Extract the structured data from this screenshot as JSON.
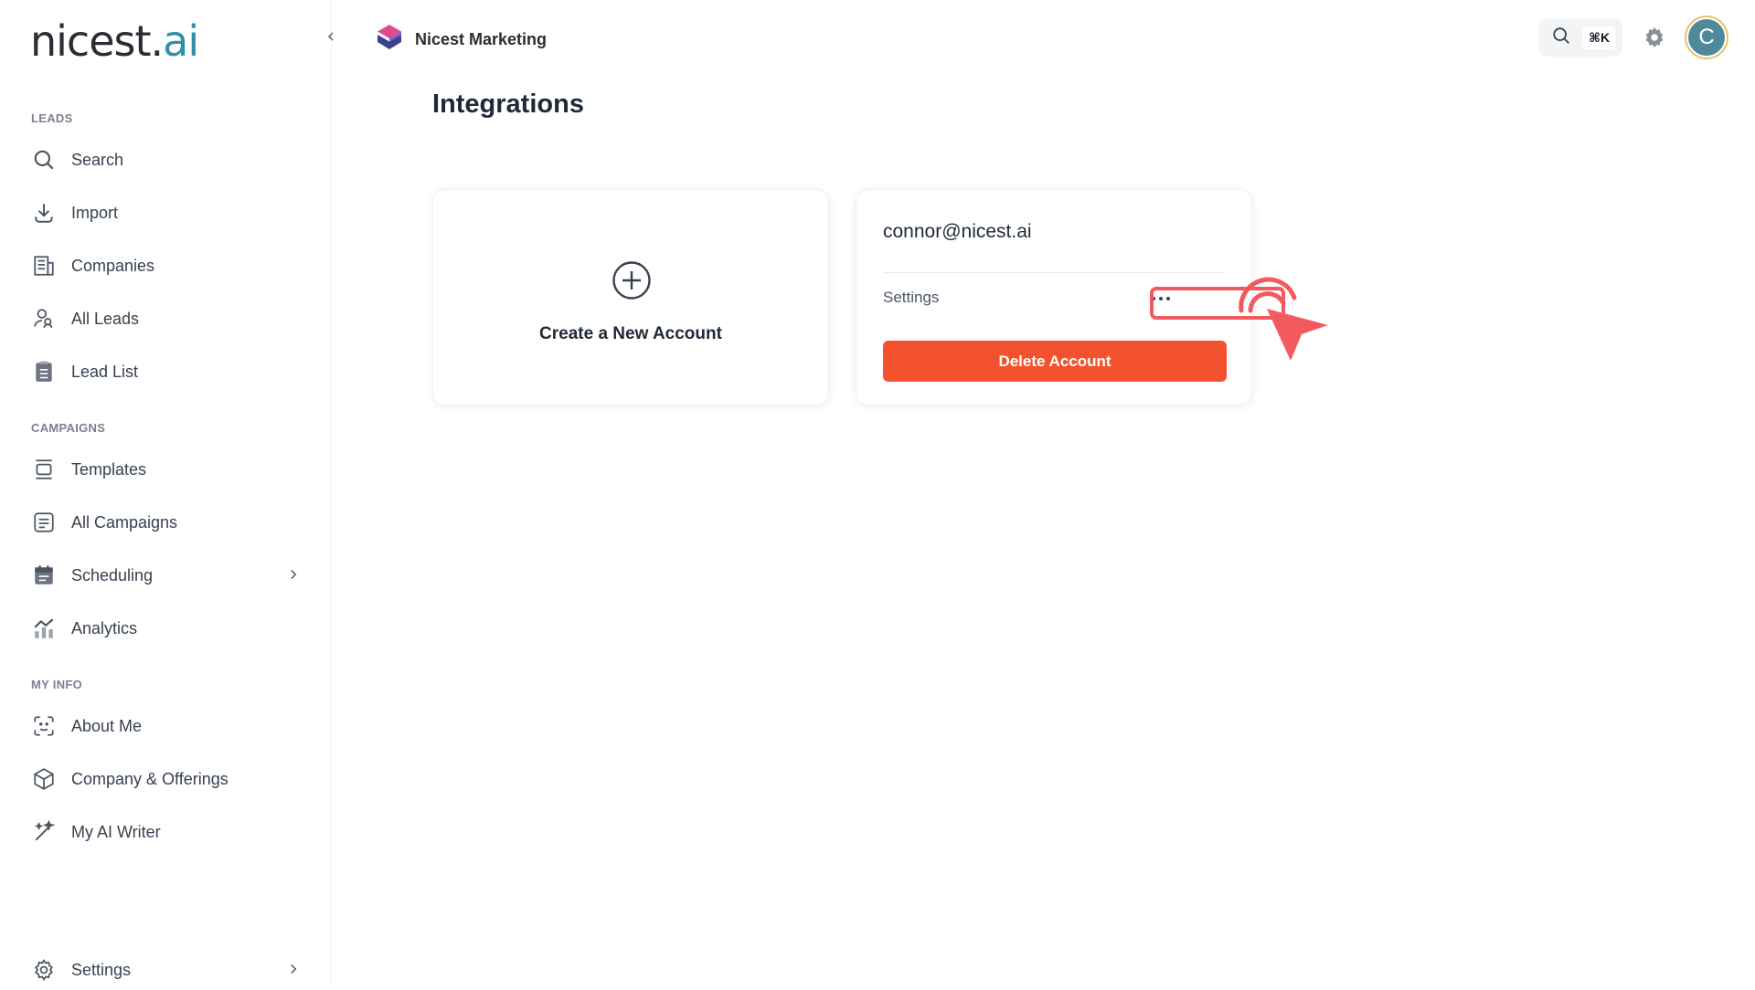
{
  "brand": {
    "logo_main": "nicest.",
    "logo_accent": "ai"
  },
  "sidebar": {
    "sections": {
      "leads": "LEADS",
      "campaigns": "CAMPAIGNS",
      "my_info": "MY INFO"
    },
    "items": [
      {
        "label": "Search",
        "icon": "search-icon"
      },
      {
        "label": "Import",
        "icon": "download-icon"
      },
      {
        "label": "Companies",
        "icon": "building-icon"
      },
      {
        "label": "All Leads",
        "icon": "users-icon"
      },
      {
        "label": "Lead List",
        "icon": "clipboard-list-icon"
      },
      {
        "label": "Templates",
        "icon": "template-icon"
      },
      {
        "label": "All Campaigns",
        "icon": "campaigns-icon"
      },
      {
        "label": "Scheduling",
        "icon": "calendar-icon"
      },
      {
        "label": "Analytics",
        "icon": "chart-icon"
      },
      {
        "label": "About Me",
        "icon": "face-icon"
      },
      {
        "label": "Company & Offerings",
        "icon": "box-icon"
      },
      {
        "label": "My AI Writer",
        "icon": "magic-wand-icon"
      },
      {
        "label": "Settings",
        "icon": "gear-icon"
      }
    ]
  },
  "header": {
    "workspace_name": "Nicest Marketing",
    "search_shortcut": "⌘K",
    "avatar_initial": "C"
  },
  "main": {
    "title": "Integrations",
    "new_account_card": {
      "label": "Create a New Account"
    },
    "account_card": {
      "email": "connor@nicest.ai",
      "settings_label": "Settings",
      "delete_label": "Delete Account"
    }
  },
  "colors": {
    "accent": "#2f8fa8",
    "danger": "#f4522f",
    "annotation": "#f25a5f",
    "avatar_bg": "#4f8a9c"
  }
}
